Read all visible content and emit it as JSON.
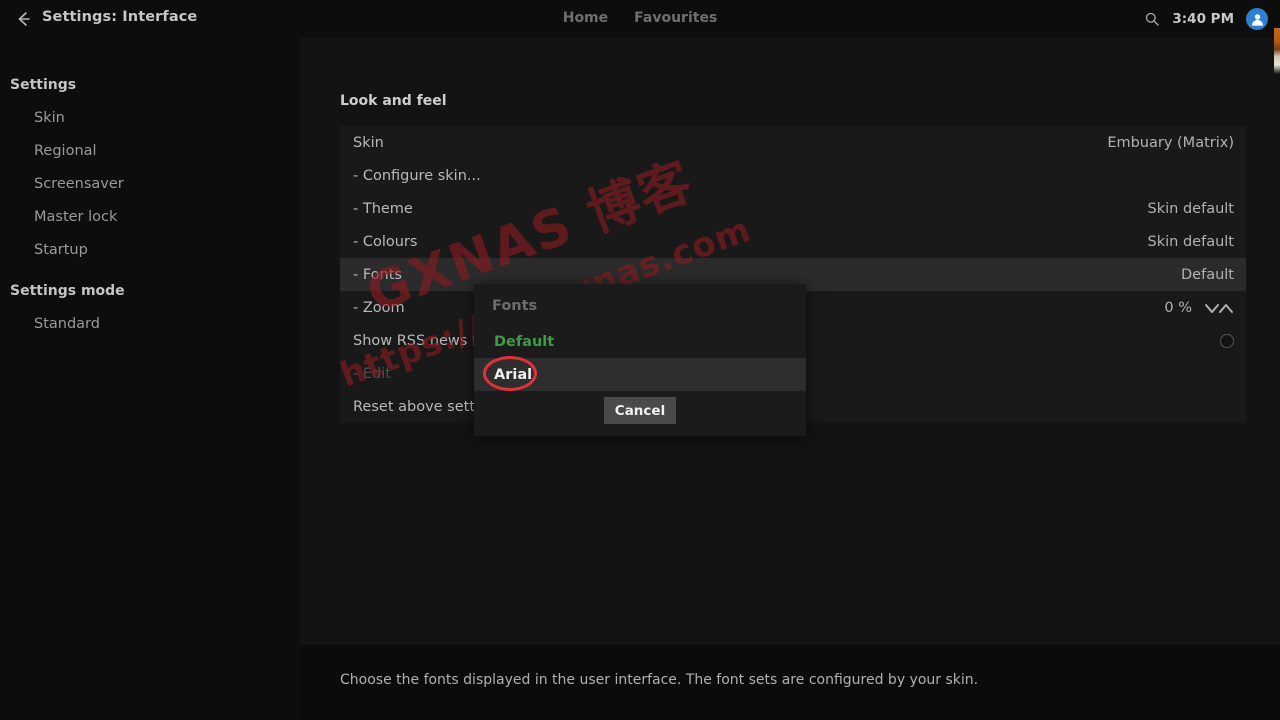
{
  "window": {
    "title": "Settings: Interface",
    "back_icon": "back-arrow-icon"
  },
  "topnav": {
    "items": [
      {
        "label": "Home"
      },
      {
        "label": "Favourites"
      }
    ]
  },
  "tray": {
    "search_icon": "search-icon",
    "clock": "3:40 PM",
    "avatar_icon": "user-avatar-icon"
  },
  "sidebar": {
    "groups": [
      {
        "heading": "Settings",
        "items": [
          {
            "label": "Skin"
          },
          {
            "label": "Regional"
          },
          {
            "label": "Screensaver"
          },
          {
            "label": "Master lock"
          },
          {
            "label": "Startup"
          }
        ]
      },
      {
        "heading": "Settings mode",
        "items": [
          {
            "label": "Standard"
          }
        ]
      }
    ]
  },
  "main": {
    "section_title": "Look and feel",
    "rows": [
      {
        "label": "Skin",
        "value": "Embuary (Matrix)",
        "selected": false,
        "dim": false,
        "control": "none"
      },
      {
        "label": "- Configure skin...",
        "value": "",
        "selected": false,
        "dim": false,
        "control": "none"
      },
      {
        "label": "- Theme",
        "value": "Skin default",
        "selected": false,
        "dim": false,
        "control": "none"
      },
      {
        "label": "- Colours",
        "value": "Skin default",
        "selected": false,
        "dim": false,
        "control": "none"
      },
      {
        "label": "- Fonts",
        "value": "Default",
        "selected": true,
        "dim": false,
        "control": "none"
      },
      {
        "label": "- Zoom",
        "value": "0 %",
        "selected": false,
        "dim": false,
        "control": "spinner"
      },
      {
        "label": "Show RSS news feeds",
        "value": "",
        "selected": false,
        "dim": false,
        "control": "radio"
      },
      {
        "label": "- Edit",
        "value": "",
        "selected": false,
        "dim": true,
        "control": "none"
      },
      {
        "label": "Reset above settings to default",
        "value": "",
        "selected": false,
        "dim": false,
        "control": "none"
      }
    ],
    "description": "Choose the fonts displayed in the user interface. The font sets are configured by your skin."
  },
  "dialog": {
    "title": "Fonts",
    "options": [
      {
        "label": "Default",
        "state": "current"
      },
      {
        "label": "Arial",
        "state": "selected"
      }
    ],
    "cancel_label": "Cancel"
  },
  "annotation": {
    "shape": "ellipse",
    "color": "#e3303a",
    "target": "Arial"
  },
  "watermark": {
    "line1": "GXNAS 博客",
    "line2": "https://wp.gxnas.com"
  },
  "colors": {
    "accent_green": "#3f9a43",
    "annotation_red": "#e3303a",
    "avatar_blue": "#2f7fd0",
    "panel_bg": "#131313",
    "row_bg": "#191919",
    "row_selected": "#2b2b2b",
    "dialog_bg": "#1b1b1b"
  }
}
